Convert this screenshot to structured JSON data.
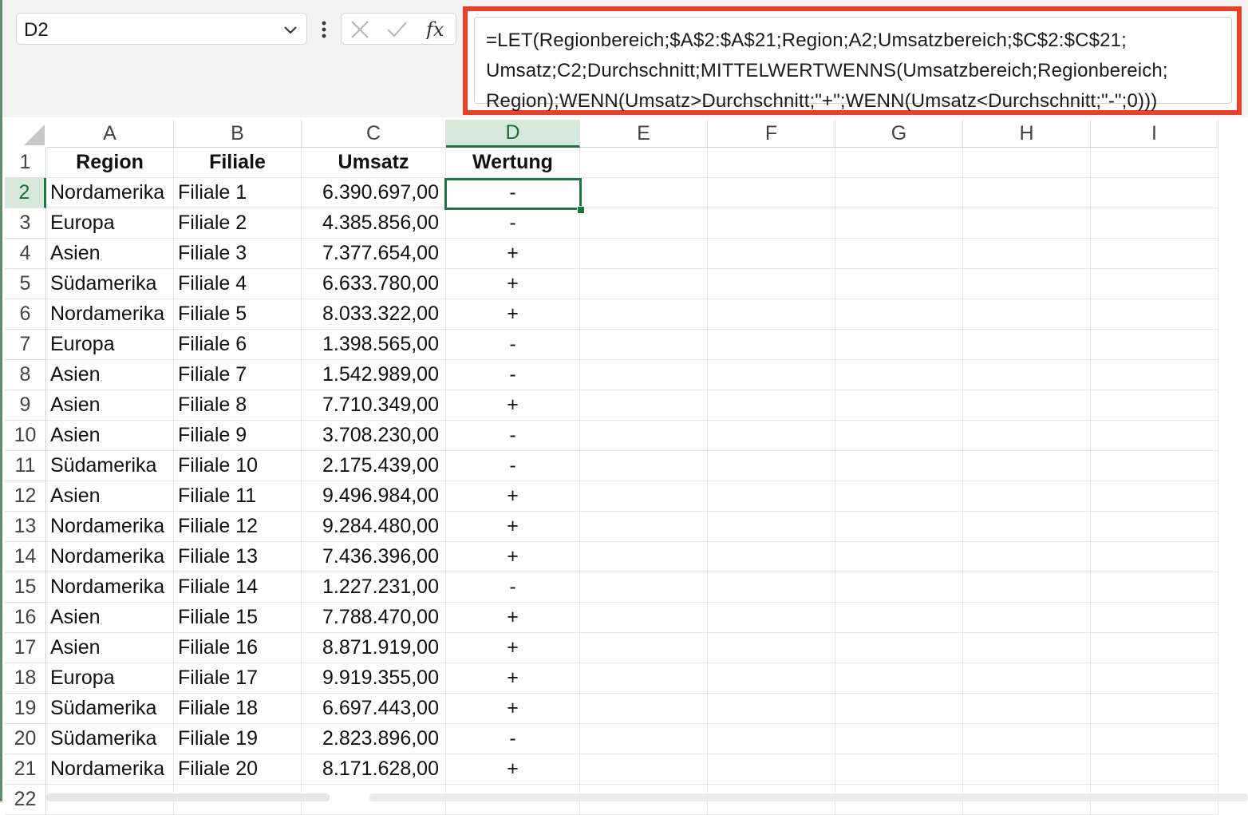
{
  "name_box": {
    "value": "D2"
  },
  "formula_bar": {
    "formula_text": "=LET(Regionbereich;$A$2:$A$21;Region;A2;Umsatzbereich;$C$2:$C$21;\nUmsatz;C2;Durchschnitt;MITTELWERTWENNS(Umsatzbereich;Regionbereich;\nRegion);WENN(Umsatz>Durchschnitt;\"+\";WENN(Umsatz<Durchschnitt;\"-\";0)))",
    "highlight_color": "#e8412a"
  },
  "accent_color": "#217346",
  "columns": [
    "A",
    "B",
    "C",
    "D",
    "E",
    "F",
    "G",
    "H",
    "I"
  ],
  "row_numbers": [
    "1",
    "2",
    "3",
    "4",
    "5",
    "6",
    "7",
    "8",
    "9",
    "10",
    "11",
    "12",
    "13",
    "14",
    "15",
    "16",
    "17",
    "18",
    "19",
    "20",
    "21",
    "22"
  ],
  "selected": {
    "column": "D",
    "row": "2"
  },
  "headers": [
    "Region",
    "Filiale",
    "Umsatz",
    "Wertung"
  ],
  "rows": [
    [
      "Nordamerika",
      "Filiale 1",
      "6.390.697,00",
      "-"
    ],
    [
      "Europa",
      "Filiale 2",
      "4.385.856,00",
      "-"
    ],
    [
      "Asien",
      "Filiale 3",
      "7.377.654,00",
      "+"
    ],
    [
      "Südamerika",
      "Filiale 4",
      "6.633.780,00",
      "+"
    ],
    [
      "Nordamerika",
      "Filiale 5",
      "8.033.322,00",
      "+"
    ],
    [
      "Europa",
      "Filiale 6",
      "1.398.565,00",
      "-"
    ],
    [
      "Asien",
      "Filiale 7",
      "1.542.989,00",
      "-"
    ],
    [
      "Asien",
      "Filiale 8",
      "7.710.349,00",
      "+"
    ],
    [
      "Asien",
      "Filiale 9",
      "3.708.230,00",
      "-"
    ],
    [
      "Südamerika",
      "Filiale 10",
      "2.175.439,00",
      "-"
    ],
    [
      "Asien",
      "Filiale 11",
      "9.496.984,00",
      "+"
    ],
    [
      "Nordamerika",
      "Filiale 12",
      "9.284.480,00",
      "+"
    ],
    [
      "Nordamerika",
      "Filiale 13",
      "7.436.396,00",
      "+"
    ],
    [
      "Nordamerika",
      "Filiale 14",
      "1.227.231,00",
      "-"
    ],
    [
      "Asien",
      "Filiale 15",
      "7.788.470,00",
      "+"
    ],
    [
      "Asien",
      "Filiale 16",
      "8.871.919,00",
      "+"
    ],
    [
      "Europa",
      "Filiale 17",
      "9.919.355,00",
      "+"
    ],
    [
      "Südamerika",
      "Filiale 18",
      "6.697.443,00",
      "+"
    ],
    [
      "Südamerika",
      "Filiale 19",
      "2.823.896,00",
      "-"
    ],
    [
      "Nordamerika",
      "Filiale 20",
      "8.171.628,00",
      "+"
    ]
  ]
}
